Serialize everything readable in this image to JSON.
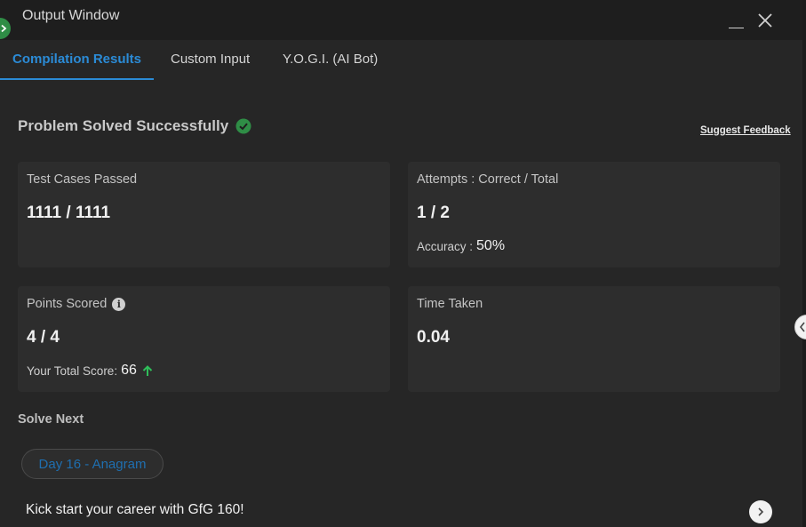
{
  "window": {
    "title": "Output Window"
  },
  "tabs": [
    {
      "label": "Compilation Results",
      "active": true
    },
    {
      "label": "Custom Input",
      "active": false
    },
    {
      "label": "Y.O.G.I. (AI Bot)",
      "active": false
    }
  ],
  "result": {
    "heading": "Problem Solved Successfully",
    "feedback_link": "Suggest Feedback"
  },
  "cards": {
    "test_cases": {
      "label": "Test Cases Passed",
      "value": "1111 / 1111"
    },
    "attempts": {
      "label": "Attempts : Correct / Total",
      "value": "1 / 2",
      "accuracy_label": "Accuracy :",
      "accuracy_value": "50%"
    },
    "points": {
      "label": "Points Scored",
      "value": "4 / 4",
      "total_label": "Your Total Score:",
      "total_value": "66"
    },
    "time": {
      "label": "Time Taken",
      "value": "0.04"
    }
  },
  "solve_next": {
    "heading": "Solve Next",
    "problem": "Day 16 - Anagram"
  },
  "promo": {
    "text": "Kick start your career with GfG 160!"
  },
  "colors": {
    "accent": "#2b8bd6",
    "success": "#2f8d46",
    "increase": "#2fbf5a",
    "background": "#262626",
    "card": "#2d2d2d"
  },
  "icons": {
    "run": "play-chevron-icon",
    "minimize": "minimize-icon",
    "close": "close-icon",
    "success": "check-circle-icon",
    "info": "info-icon",
    "increase": "arrow-up-icon",
    "next": "chevron-right-icon",
    "panel_toggle": "chevron-left-icon"
  }
}
